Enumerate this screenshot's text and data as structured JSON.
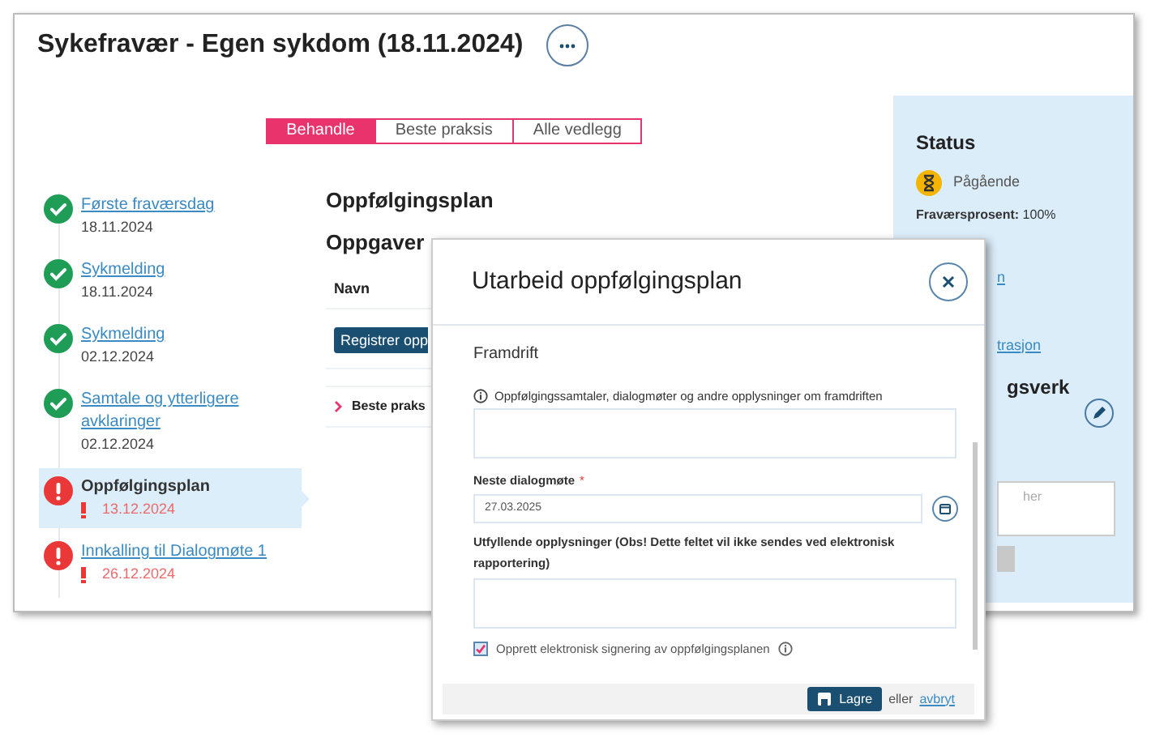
{
  "page": {
    "title": "Sykefravær - Egen sykdom (18.11.2024)",
    "tabs": [
      {
        "label": "Behandle",
        "selected": true
      },
      {
        "label": "Beste praksis",
        "selected": false
      },
      {
        "label": "Alle vedlegg",
        "selected": false
      }
    ],
    "timeline": [
      {
        "label": "Første fraværsdag",
        "date": "18.11.2024",
        "kind": "done",
        "selected": false
      },
      {
        "label": "Sykmelding",
        "date": "18.11.2024",
        "kind": "done",
        "selected": false
      },
      {
        "label": "Sykmelding",
        "date": "02.12.2024",
        "kind": "done",
        "selected": false
      },
      {
        "label": "Samtale og ytterligere avklaringer",
        "date": "02.12.2024",
        "kind": "done",
        "selected": false
      },
      {
        "label": "Oppfølgingsplan",
        "date": "13.12.2024",
        "kind": "overdue",
        "selected": true
      },
      {
        "label": "Innkalling til Dialogmøte 1",
        "date": "26.12.2024",
        "kind": "overdue",
        "selected": false
      }
    ],
    "main": {
      "heading": "Oppfølgingsplan",
      "subheading": "Oppgaver",
      "column_header": "Navn",
      "task_button": "Registrer opp",
      "section": {
        "label": "Beste praks",
        "expanded": false
      }
    },
    "status_panel": {
      "heading": "Status",
      "status": "Pågående",
      "absence": "**Fraværsprosent:** 100%",
      "link_1": "n",
      "link_2": "trasjon",
      "heading_2": "gsverk",
      "textarea_placeholder": "her"
    }
  },
  "dialog": {
    "title": "Utarbeid oppfølgingsplan",
    "section": "Framdrift",
    "progress_label": "Oppfølgingssamtaler, dialogmøter og andre opplysninger om framdriften",
    "date_label": "Neste dialogmøte",
    "required_mark": "*",
    "date_value": "27.03.2025",
    "details_label": "Utfyllende opplysninger (Obs! Dette feltet vil ikke sendes ved elektronisk rapportering)",
    "signing": {
      "label": "Opprett elektronisk signering av oppfølgingsplanen",
      "checked": true
    },
    "save_button": "Lagre",
    "or_text": "eller",
    "cancel_link": "avbryt"
  }
}
